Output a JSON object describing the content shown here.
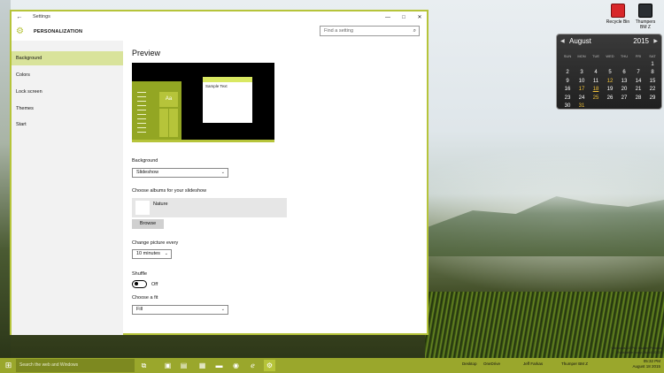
{
  "desktop": {
    "icons": [
      {
        "label": "Recycle Bin"
      },
      {
        "label": "Thumpers BM Z"
      }
    ],
    "watermark_line1": "Windows 10 Pro Insider Preview",
    "watermark_line2": "Evaluation copy. Build 10525"
  },
  "calendar": {
    "month": "August",
    "year": "2015",
    "weekdays": [
      "SUN",
      "MON",
      "TUE",
      "WED",
      "THU",
      "FRI",
      "SAT"
    ],
    "days": [
      "",
      "",
      "",
      "",
      "",
      "",
      "1",
      "2",
      "3",
      "4",
      "5",
      "6",
      "7",
      "8",
      "9",
      "10",
      "11",
      "12",
      "13",
      "14",
      "15",
      "16",
      "17",
      "18",
      "19",
      "20",
      "21",
      "22",
      "23",
      "24",
      "25",
      "26",
      "27",
      "28",
      "29",
      "30",
      "31",
      "",
      "",
      "",
      "",
      ""
    ],
    "highlighted": [
      "12",
      "17",
      "25",
      "31"
    ],
    "today": "18"
  },
  "window": {
    "title": "Settings",
    "section": "PERSONALIZATION",
    "search_placeholder": "Find a setting",
    "nav": [
      {
        "label": "Background",
        "active": true
      },
      {
        "label": "Colors"
      },
      {
        "label": "Lock screen"
      },
      {
        "label": "Themes"
      },
      {
        "label": "Start"
      }
    ]
  },
  "content": {
    "preview_title": "Preview",
    "preview_tile_label": "Aa",
    "preview_sample_text": "Sample Text",
    "background_label": "Background",
    "background_value": "Slideshow",
    "albums_label": "Choose albums for your slideshow",
    "album_name": "Nature",
    "browse_label": "Browse",
    "change_label": "Change picture every",
    "change_value": "10 minutes",
    "shuffle_label": "Shuffle",
    "shuffle_state": "Off",
    "fit_label": "Choose a fit",
    "fit_value": "Fill"
  },
  "taskbar": {
    "search_placeholder": "Search the web and Windows",
    "tray": {
      "desktop": "Desktop",
      "onedrive": "OneDrive",
      "user": "Jeff Farkas",
      "drive": "Thumper BM Z"
    },
    "time": "05:32 PM",
    "date": "August 18 2015"
  },
  "colors": {
    "accent": "#b6c43a",
    "accent_light": "#d9e39b",
    "taskbar": "#9aa72c"
  }
}
